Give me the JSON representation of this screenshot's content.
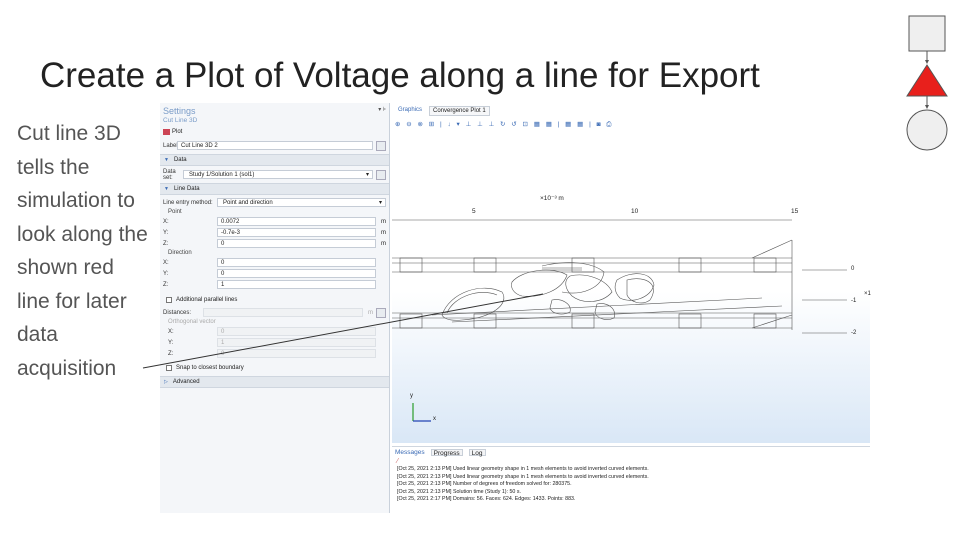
{
  "slide": {
    "title": "Create a Plot of Voltage along a line for Export",
    "side_text": "Cut line 3D tells the simulation to look along the shown red line for later data acquisition"
  },
  "settings": {
    "header": "Settings",
    "pins": "▾ ⊧",
    "subtitle": "Cut Line 3D",
    "plot_button": "Plot",
    "label_field_label": "Label:",
    "label_value": "Cut Line 3D 2",
    "data_section": "Data",
    "dataset_label": "Data set:",
    "dataset_value": "Study 1/Solution 1 (sol1)",
    "line_data_section": "Line Data",
    "line_entry_label": "Line entry method:",
    "line_entry_value": "Point and direction",
    "point_group": "Point",
    "point": [
      {
        "label": "X:",
        "value": "0.0072",
        "unit": "m"
      },
      {
        "label": "Y:",
        "value": "-0.7e-3",
        "unit": "m"
      },
      {
        "label": "Z:",
        "value": "0",
        "unit": "m"
      }
    ],
    "direction_group": "Direction",
    "direction": [
      {
        "label": "X:",
        "value": "0"
      },
      {
        "label": "Y:",
        "value": "0"
      },
      {
        "label": "Z:",
        "value": "1"
      }
    ],
    "additional_parallel": "Additional parallel lines",
    "distances_label": "Distances:",
    "distances_unit": "m",
    "orthogonal_group": "Orthogonal vector",
    "orthogonal": [
      {
        "label": "X:",
        "value": "0"
      },
      {
        "label": "Y:",
        "value": "1"
      },
      {
        "label": "Z:",
        "value": "0"
      }
    ],
    "snap_label": "Snap to closest boundary",
    "advanced_section": "Advanced"
  },
  "graphics": {
    "tab_graphics": "Graphics",
    "tab_convergence": "Convergence Plot 1",
    "toolbar_glyphs": "⊕ ⊖ ⊗ ⊞ | ↓ ▾ ⊥ ⊥ ⊥ ↻ ↺ ⊡ ▦ ▦ | ▦ ▦ | ◙ ⎙",
    "axis_unit": "×10⁻³ m",
    "x_ticks": [
      "5",
      "10",
      "15"
    ],
    "y_ticks": [
      "0",
      "-1",
      "-2"
    ],
    "y_tick_extra": "×1",
    "axis_y": "y",
    "axis_x": "x"
  },
  "messages": {
    "tab_messages": "Messages",
    "tab_progress": "Progress",
    "tab_log": "Log",
    "lines": [
      "[Oct 25, 2021 2:13 PM] Used linear geometry shape in 1 mesh elements to avoid inverted curved elements.",
      "[Oct 25, 2021 2:13 PM] Used linear geometry shape in 1 mesh elements to avoid inverted curved elements.",
      "[Oct 25, 2021 2:13 PM] Number of degrees of freedom solved for: 280375.",
      "[Oct 25, 2021 2:13 PM] Solution time (Study 1): 50 s.",
      "[Oct 25, 2021 2:17 PM] Domains: 56.  Faces: 624.  Edges: 1433.  Points: 883."
    ]
  },
  "colors": {
    "accent": "#3b6bb5",
    "triangle": "#e8201c",
    "shape_fill": "#efefef"
  }
}
